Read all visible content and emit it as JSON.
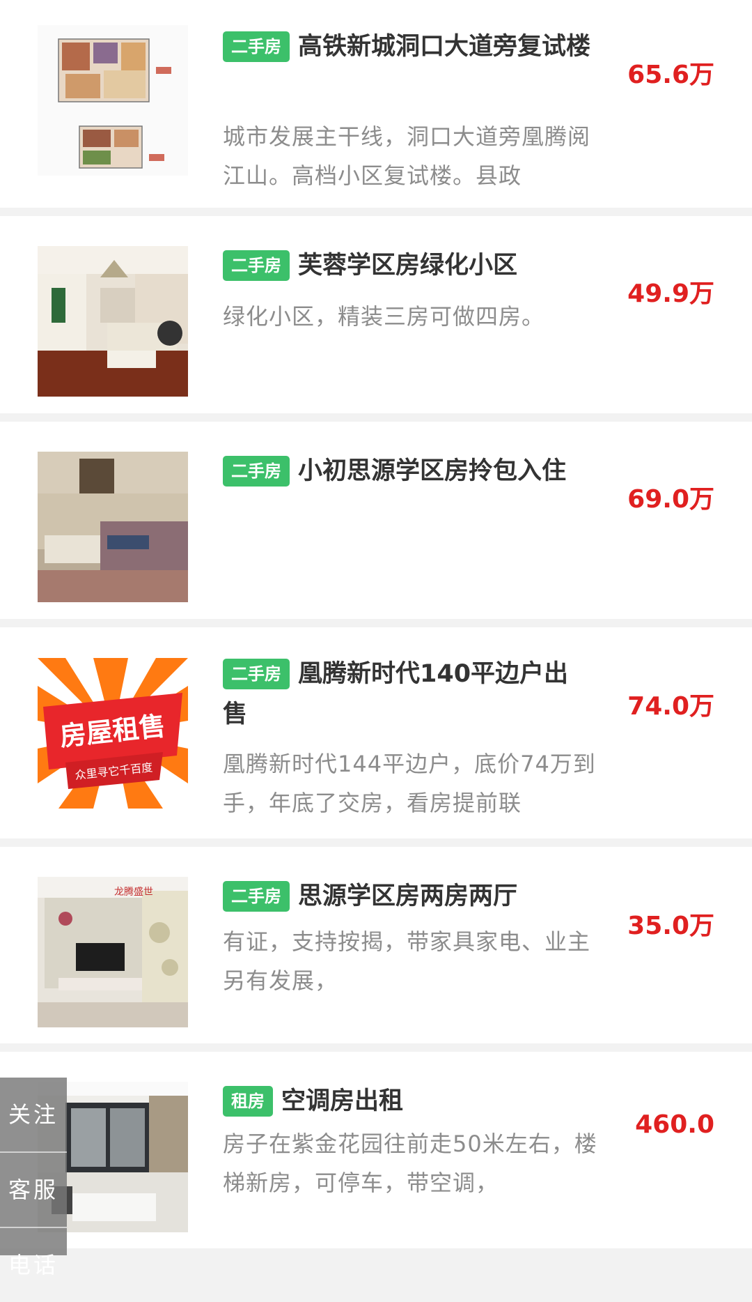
{
  "listings": [
    {
      "tag": "二手房",
      "title": "高铁新城洞口大道旁复试楼",
      "desc": "城市发展主干线，洞口大道旁凰腾阅江山。高档小区复试楼。县政",
      "price": "65.6万",
      "image": "floorplan-image"
    },
    {
      "tag": "二手房",
      "title": "芙蓉学区房绿化小区",
      "desc": "绿化小区，精装三房可做四房。",
      "price": "49.9万",
      "image": "living-room-photo"
    },
    {
      "tag": "二手房",
      "title": "小初思源学区房拎包入住",
      "desc": "",
      "price": "69.0万",
      "image": "living-room-photo"
    },
    {
      "tag": "二手房",
      "title": "凰腾新时代140平边户出售",
      "desc": "凰腾新时代144平边户，底价74万到手，年底了交房，看房提前联",
      "price": "74.0万",
      "image": "promo-banner",
      "banner_title": "房屋租售",
      "banner_sub": "众里寻它千百度"
    },
    {
      "tag": "二手房",
      "title": "思源学区房两房两厅",
      "desc": "有证，支持按揭，带家具家电、业主另有发展，",
      "price": "35.0万",
      "image": "living-room-photo",
      "wall_text": "龙腾盛世"
    },
    {
      "tag": "租房",
      "title": "空调房出租",
      "desc": "房子在紫金花园往前走50米左右，楼梯新房，可停车，带空调，",
      "price": "460.0",
      "image": "bedroom-photo"
    }
  ],
  "side_nav": {
    "follow": "关注",
    "service": "客服",
    "third": "电话"
  },
  "colors": {
    "tag_green": "#3cc06a",
    "price_red": "#e02020"
  }
}
